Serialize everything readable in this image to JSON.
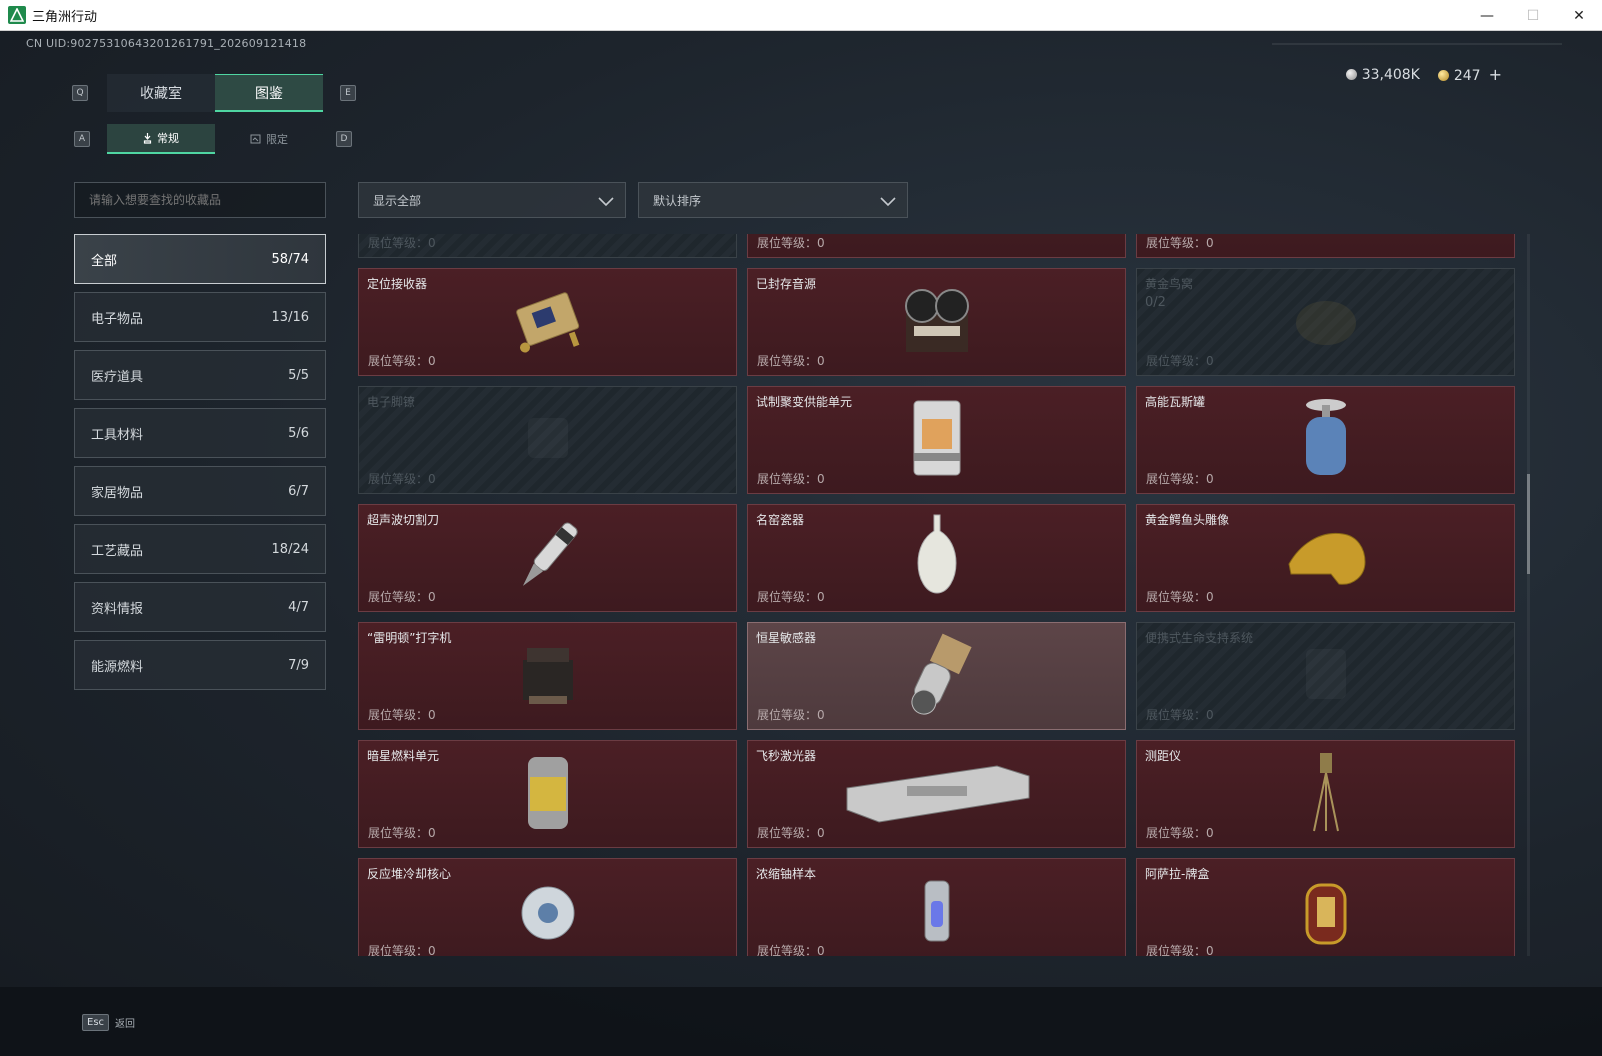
{
  "window": {
    "title": "三角洲行动",
    "controls": {
      "minimize": "—",
      "maximize": "☐",
      "close": "✕"
    }
  },
  "header": {
    "uid": "CN UID:90275310643201261791_202609121418",
    "currency": {
      "silver": "33,408K",
      "gold": "247",
      "add": "+"
    }
  },
  "tabs": {
    "main": [
      {
        "label": "收藏室",
        "active": false
      },
      {
        "label": "图鉴",
        "active": true
      }
    ],
    "sub": [
      {
        "label": "常规",
        "active": true
      },
      {
        "label": "限定",
        "active": false
      }
    ],
    "keys": {
      "prev_main": "Q",
      "next_main": "E",
      "prev_sub": "A",
      "next_sub": "D"
    }
  },
  "search": {
    "placeholder": "请输入想要查找的收藏品"
  },
  "filters": {
    "display": {
      "value": "显示全部"
    },
    "sort": {
      "value": "默认排序"
    }
  },
  "categories": [
    {
      "label": "全部",
      "count": "58/74",
      "active": true
    },
    {
      "label": "电子物品",
      "count": "13/16"
    },
    {
      "label": "医疗道具",
      "count": "5/5"
    },
    {
      "label": "工具材料",
      "count": "5/6"
    },
    {
      "label": "家居物品",
      "count": "6/7"
    },
    {
      "label": "工艺藏品",
      "count": "18/24"
    },
    {
      "label": "资料情报",
      "count": "4/7"
    },
    {
      "label": "能源燃料",
      "count": "7/9"
    }
  ],
  "level_label": "展位等级：0",
  "items": [
    {
      "name": "",
      "locked": true,
      "icon": "locked-item-icon"
    },
    {
      "name": "",
      "locked": false,
      "icon": "map-document-icon"
    },
    {
      "name": "",
      "locked": false,
      "icon": "framed-painting-icon"
    },
    {
      "name": "定位接收器",
      "locked": false,
      "icon": "receiver-icon"
    },
    {
      "name": "已封存音源",
      "locked": false,
      "icon": "reel-recorder-icon"
    },
    {
      "name": "黄金鸟窝",
      "locked": true,
      "sub": "0/2",
      "icon": "golden-nest-icon"
    },
    {
      "name": "电子脚镣",
      "locked": true,
      "icon": "ankle-monitor-icon"
    },
    {
      "name": "试制聚变供能单元",
      "locked": false,
      "icon": "fusion-unit-icon"
    },
    {
      "name": "高能瓦斯罐",
      "locked": false,
      "icon": "gas-canister-icon"
    },
    {
      "name": "超声波切割刀",
      "locked": false,
      "icon": "ultrasonic-cutter-icon"
    },
    {
      "name": "名窑瓷器",
      "locked": false,
      "icon": "porcelain-vase-icon"
    },
    {
      "name": "黄金鳄鱼头雕像",
      "locked": false,
      "icon": "golden-crocodile-icon"
    },
    {
      "name": "“雷明顿”打字机",
      "locked": false,
      "icon": "typewriter-icon"
    },
    {
      "name": "恒星敏感器",
      "locked": false,
      "highlight": true,
      "icon": "star-sensor-icon"
    },
    {
      "name": "便携式生命支持系统",
      "locked": true,
      "icon": "life-support-icon"
    },
    {
      "name": "暗星燃料单元",
      "locked": false,
      "icon": "fuel-cell-icon"
    },
    {
      "name": "飞秒激光器",
      "locked": false,
      "icon": "femtosecond-laser-icon"
    },
    {
      "name": "测距仪",
      "locked": false,
      "icon": "rangefinder-icon"
    },
    {
      "name": "反应堆冷却核心",
      "locked": false,
      "icon": "reactor-core-icon"
    },
    {
      "name": "浓缩铀样本",
      "locked": false,
      "icon": "uranium-sample-icon"
    },
    {
      "name": "阿萨拉-牌盒",
      "locked": false,
      "icon": "card-box-icon"
    }
  ],
  "footer": {
    "key": "Esc",
    "label": "返回"
  }
}
